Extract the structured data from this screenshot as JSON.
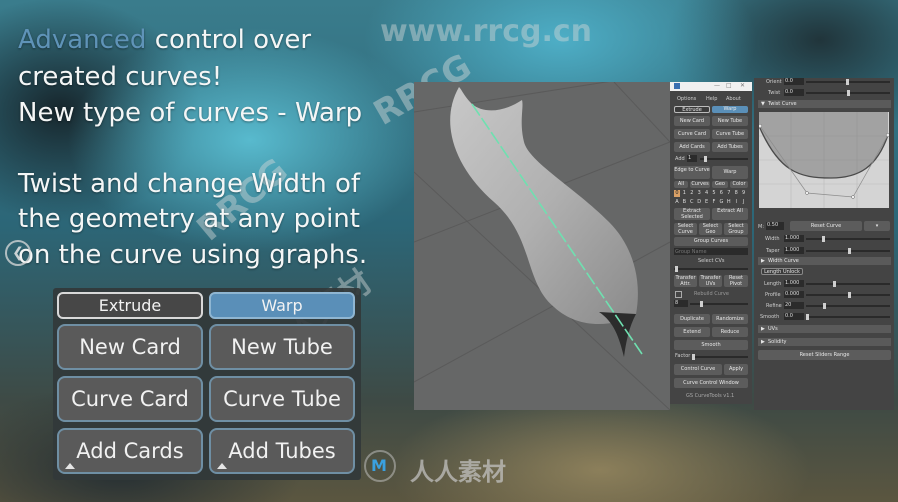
{
  "headline": {
    "line1_accent": "Advanced",
    "line1_rest": " control over",
    "line2": "created curves!",
    "line3": "New type of curves - Warp",
    "line4": "Twist and change Width of",
    "line5": "the geometry at any point",
    "line6": "on the curve using graphs."
  },
  "watermarks": {
    "site": "www.rrcg.cn",
    "brand_latin": "RRCG",
    "brand_cn": "人人素材"
  },
  "nav": {
    "prev_icon": "chevron-left-circle-icon",
    "next_icon": "chevron-right-circle-icon"
  },
  "big_panel": {
    "mode_extrude": "Extrude",
    "mode_warp": "Warp",
    "active_mode": "Warp",
    "new_card": "New Card",
    "new_tube": "New Tube",
    "curve_card": "Curve Card",
    "curve_tube": "Curve Tube",
    "add_cards": "Add Cards",
    "add_tubes": "Add Tubes"
  },
  "tool_panel": {
    "menu": [
      "Options",
      "Help",
      "About"
    ],
    "mode_extrude": "Extrude",
    "mode_warp": "Warp",
    "new_card": "New Card",
    "new_tube": "New Tube",
    "curve_card": "Curve Card",
    "curve_tube": "Curve Tube",
    "add_cards": "Add Cards",
    "add_tubes": "Add Tubes",
    "add_label": "Add",
    "add_value": "1",
    "edge_to_curve": "Edge to Curve",
    "warp": "Warp",
    "filter_tabs": [
      "All",
      "Curves",
      "Geo",
      "Color"
    ],
    "layers_top": [
      "0",
      "1",
      "2",
      "3",
      "4",
      "5",
      "6",
      "7",
      "8",
      "9"
    ],
    "layers_bottom": [
      "A",
      "B",
      "C",
      "D",
      "E",
      "F",
      "G",
      "H",
      "I",
      "J"
    ],
    "extract_selected": "Extract Selected",
    "extract_all": "Extract All",
    "select_curve": "Select Curve",
    "select_geo": "Select Geo",
    "select_group": "Select Group",
    "group_curves": "Group Curves",
    "group_name_placeholder": "Group Name",
    "select_cvs": "Select CVs",
    "transfer_attr": "Transfer Attr.",
    "transfer_uvs": "Transfer UVs",
    "reset_pivot": "Reset Pivot",
    "rebuild_curve": "Rebuild Curve",
    "rebuild_value": "8",
    "duplicate": "Duplicate",
    "randomize": "Randomize",
    "extend": "Extend",
    "reduce": "Reduce",
    "smooth": "Smooth",
    "factor_label": "Factor",
    "control_curve": "Control Curve",
    "apply": "Apply",
    "curve_control_window": "Curve Control Window",
    "version": "GS CurveTools v1.1"
  },
  "attr_panel": {
    "orient_label": "Orient",
    "orient_value": "0.0",
    "twist_label": "Twist",
    "twist_value": "0.0",
    "twist_curve_section": "Twist Curve",
    "magnet_label": "M:",
    "magnet_value": "0.50",
    "reset_curve": "Reset Curve",
    "width_label": "Width",
    "width_value": "1.000",
    "taper_label": "Taper",
    "taper_value": "1.000",
    "width_curve_section": "Width Curve",
    "length_unlock": "Length Unlock",
    "length_label": "Length",
    "length_value": "1.000",
    "profile_label": "Profile",
    "profile_value": "0.000",
    "refine_label": "Refine",
    "refine_value": "20",
    "smooth_label": "Smooth",
    "smooth_value": "0.0",
    "uvs_section": "UVs",
    "solidity_section": "Solidity",
    "reset_sliders_range": "Reset Sliders Range"
  },
  "colors": {
    "accent_blue": "#5f93b8",
    "warp_active": "#5a8fb8",
    "curve_highlight": "#6fe0b0",
    "panel_bg": "#444444"
  }
}
